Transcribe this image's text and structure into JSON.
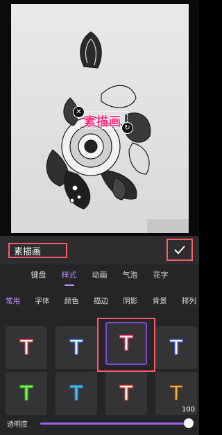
{
  "canvas": {
    "sticker_text": "素描画",
    "close_icon": "close-icon",
    "rotate_icon": "rotate-scale-icon"
  },
  "editor": {
    "text_value": "素描画",
    "confirm_icon": "checkmark-icon"
  },
  "tabs": [
    {
      "label": "键盘",
      "active": false
    },
    {
      "label": "样式",
      "active": true
    },
    {
      "label": "动画",
      "active": false
    },
    {
      "label": "气泡",
      "active": false
    },
    {
      "label": "花字",
      "active": false
    }
  ],
  "subtabs": [
    {
      "label": "常用",
      "active": true
    },
    {
      "label": "字体",
      "active": false
    },
    {
      "label": "颜色",
      "active": false
    },
    {
      "label": "描边",
      "active": false
    },
    {
      "label": "阴影",
      "active": false
    },
    {
      "label": "背景",
      "active": false
    },
    {
      "label": "排列",
      "active": false
    }
  ],
  "styles": [
    {
      "glyph": "T",
      "fill": "#f4f4f4",
      "outline": "#e0414b",
      "selected": false
    },
    {
      "glyph": "T",
      "fill": "#f4f4f4",
      "outline": "#3a78e6",
      "selected": false
    },
    {
      "glyph": "T",
      "fill": "#f4f4f4",
      "outline": "#ff3f7f",
      "selected": true
    },
    {
      "glyph": "T",
      "fill": "#f4f4f4",
      "outline": "#4a6cf0",
      "selected": false
    },
    {
      "glyph": "T",
      "fill": "#7df25b",
      "outline": "#3da42b",
      "selected": false
    },
    {
      "glyph": "T",
      "fill": "#4dbbe8",
      "outline": "#2a7fb0",
      "selected": false
    },
    {
      "glyph": "T",
      "fill": "#f4f4f4",
      "outline": "#f04b3a",
      "selected": false
    },
    {
      "glyph": "T",
      "fill": "#e9b24a",
      "outline": "#6b3b13",
      "selected": false
    }
  ],
  "opacity": {
    "label": "透明度",
    "value": "100",
    "fraction": 1.0
  },
  "colors": {
    "accent": "#c08dff",
    "highlight": "#ff5a66",
    "panel_bg": "#252527"
  }
}
